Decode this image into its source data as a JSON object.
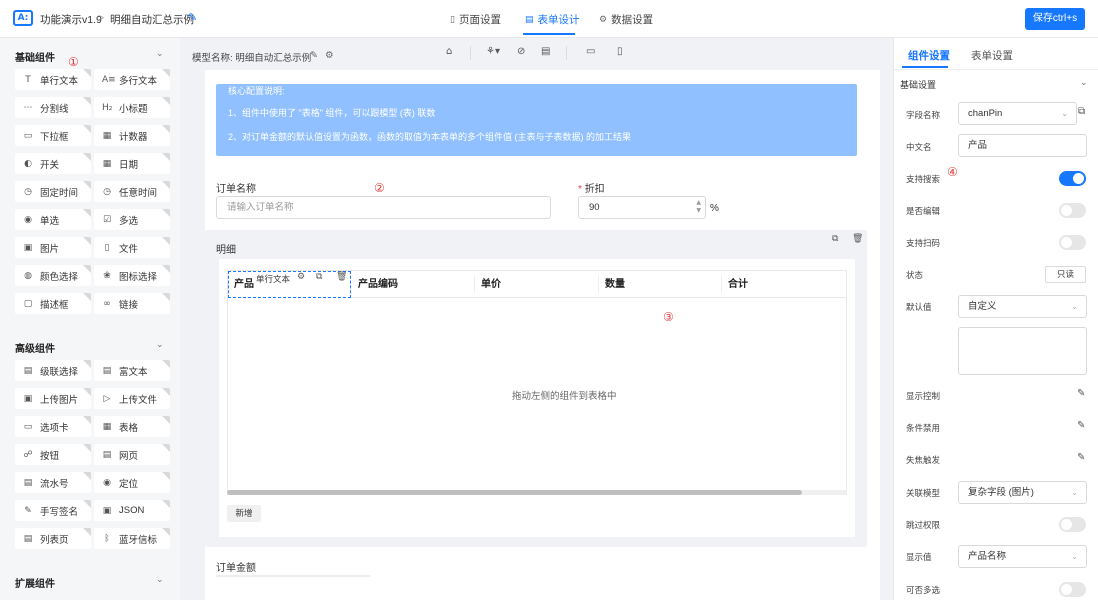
{
  "header": {
    "app_title": "功能演示v1.9",
    "breadcrumb_sep": ">",
    "page_name": "明细自动汇总示例",
    "tabs": [
      {
        "label": "页面设置",
        "icon": "page-icon"
      },
      {
        "label": "表单设计",
        "icon": "form-icon"
      },
      {
        "label": "数据设置",
        "icon": "gear-icon"
      }
    ],
    "save_label": "保存ctrl+s"
  },
  "sidebar": {
    "sections": [
      {
        "title": "基础组件",
        "items": [
          "单行文本",
          "多行文本",
          "分割线",
          "小标题",
          "下拉框",
          "计数器",
          "开关",
          "日期",
          "固定时间",
          "任意时间",
          "单选",
          "多选",
          "图片",
          "文件",
          "颜色选择",
          "图标选择",
          "描述框",
          "链接"
        ]
      },
      {
        "title": "高级组件",
        "items": [
          "级联选择",
          "富文本",
          "上传图片",
          "上传文件",
          "选项卡",
          "表格",
          "按钮",
          "网页",
          "流水号",
          "定位",
          "手写签名",
          "JSON",
          "列表页",
          "蓝牙信标"
        ]
      },
      {
        "title": "扩展组件",
        "items": []
      }
    ]
  },
  "canvas": {
    "model_label": "模型名称: 明细自动汇总示例",
    "info_title": "核心配置说明:",
    "info_line1": "1、组件中使用了 \"表格\" 组件，可以跟模型 (表) 联数",
    "info_line2": "2、对订单金额的默认值设置为函数，函数的取值为本表单的多个组件值 (主表与子表数据) 的加工结果",
    "order_name_label": "订单名称",
    "order_name_placeholder": "请输入订单名称",
    "discount_required": "*",
    "discount_label": "折扣",
    "discount_value": "90",
    "discount_unit": "%",
    "detail_label": "明细",
    "table_headers": [
      "产品",
      "产品编码",
      "单价",
      "数量",
      "合计"
    ],
    "selected_col_tag": "单行文本",
    "empty_hint": "拖动左侧的组件到表格中",
    "add_label": "新增",
    "order_amount_label": "订单金额"
  },
  "markers": {
    "m1": "①",
    "m2": "②",
    "m3": "③",
    "m4": "④"
  },
  "panel": {
    "tabs": [
      "组件设置",
      "表单设置"
    ],
    "section": "基础设置",
    "field_name_label": "字段名称",
    "field_name_value": "chanPin",
    "cn_name_label": "中文名",
    "cn_name_value": "产品",
    "searchable_label": "支持搜索",
    "searchable": true,
    "editable_label": "是否编辑",
    "editable": false,
    "scan_label": "支持扫码",
    "scan": false,
    "status_label": "状态",
    "status_value": "只读",
    "default_label": "默认值",
    "default_value": "自定义",
    "display_ctrl_label": "显示控制",
    "cond_disable_label": "条件禁用",
    "blur_trigger_label": "失焦触发",
    "rel_model_label": "关联模型",
    "rel_model_value": "复杂字段 (图片)",
    "skip_auth_label": "跳过权限",
    "skip_auth": false,
    "display_value_label": "显示值",
    "display_value_value": "产品名称",
    "multi_label": "可否多选",
    "multi": false
  },
  "colors": {
    "accent": "#1677ff",
    "marker": "#e03b3b",
    "info_bg": "#90c0ff"
  }
}
